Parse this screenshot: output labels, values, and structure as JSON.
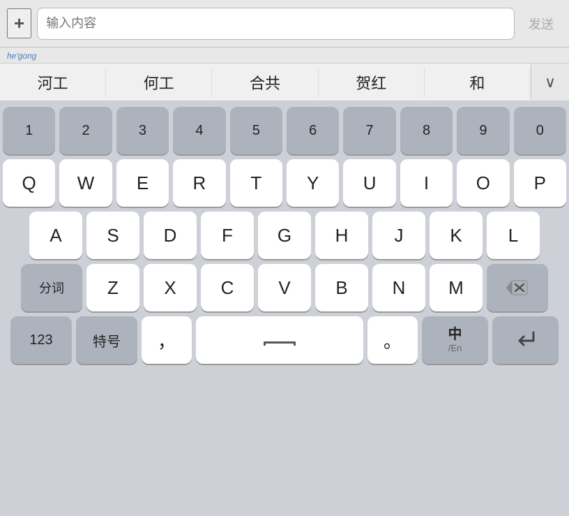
{
  "topbar": {
    "plus_label": "+",
    "input_placeholder": "输入内容",
    "send_label": "发送",
    "pinyin": "he'gong"
  },
  "candidates": {
    "items": [
      "河工",
      "何工",
      "合共",
      "贺红",
      "和"
    ],
    "expand_icon": "∨"
  },
  "keyboard": {
    "rows": [
      {
        "id": "numbers",
        "keys": [
          {
            "label": "1",
            "type": "dark"
          },
          {
            "label": "2",
            "type": "dark"
          },
          {
            "label": "3",
            "type": "dark"
          },
          {
            "label": "4",
            "type": "dark"
          },
          {
            "label": "5",
            "type": "dark"
          },
          {
            "label": "6",
            "type": "dark"
          },
          {
            "label": "7",
            "type": "dark"
          },
          {
            "label": "8",
            "type": "dark"
          },
          {
            "label": "9",
            "type": "dark"
          },
          {
            "label": "0",
            "type": "dark"
          }
        ]
      },
      {
        "id": "qwerty",
        "keys": [
          {
            "label": "Q",
            "type": "normal"
          },
          {
            "label": "W",
            "type": "normal"
          },
          {
            "label": "E",
            "type": "normal"
          },
          {
            "label": "R",
            "type": "normal"
          },
          {
            "label": "T",
            "type": "normal"
          },
          {
            "label": "Y",
            "type": "normal"
          },
          {
            "label": "U",
            "type": "normal"
          },
          {
            "label": "I",
            "type": "normal"
          },
          {
            "label": "O",
            "type": "normal"
          },
          {
            "label": "P",
            "type": "normal"
          }
        ]
      },
      {
        "id": "asdf",
        "keys": [
          {
            "label": "A",
            "type": "normal"
          },
          {
            "label": "S",
            "type": "normal"
          },
          {
            "label": "D",
            "type": "normal"
          },
          {
            "label": "F",
            "type": "normal"
          },
          {
            "label": "G",
            "type": "normal"
          },
          {
            "label": "H",
            "type": "normal"
          },
          {
            "label": "J",
            "type": "normal"
          },
          {
            "label": "K",
            "type": "normal"
          },
          {
            "label": "L",
            "type": "normal"
          }
        ]
      },
      {
        "id": "zxcv",
        "keys": [
          {
            "label": "分词",
            "type": "action"
          },
          {
            "label": "Z",
            "type": "normal"
          },
          {
            "label": "X",
            "type": "normal"
          },
          {
            "label": "C",
            "type": "normal"
          },
          {
            "label": "V",
            "type": "normal"
          },
          {
            "label": "B",
            "type": "normal"
          },
          {
            "label": "N",
            "type": "normal"
          },
          {
            "label": "M",
            "type": "normal"
          },
          {
            "label": "backspace",
            "type": "backspace"
          }
        ]
      },
      {
        "id": "bottom",
        "keys": [
          {
            "label": "123",
            "type": "action"
          },
          {
            "label": "特号",
            "type": "action"
          },
          {
            "label": "，",
            "type": "normal"
          },
          {
            "label": "space",
            "type": "space"
          },
          {
            "label": "。",
            "type": "normal"
          },
          {
            "label": "lang",
            "type": "lang"
          },
          {
            "label": "enter",
            "type": "enter"
          }
        ]
      }
    ]
  }
}
